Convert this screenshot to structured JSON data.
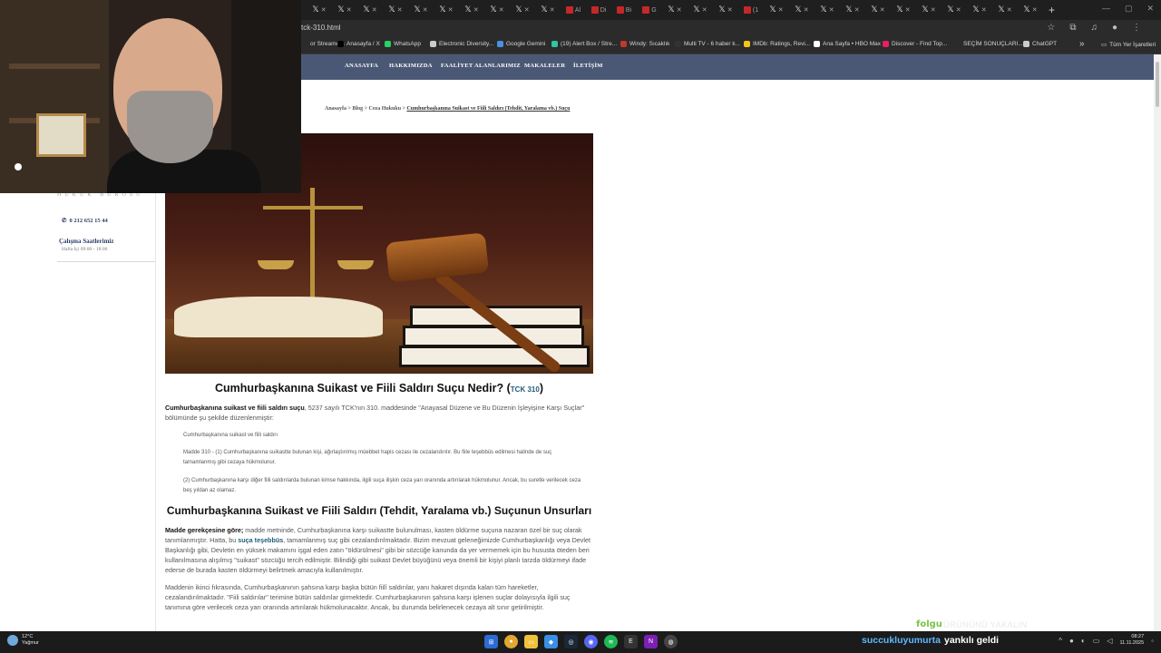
{
  "browser": {
    "url": "tck-310.html",
    "tabs": [
      {
        "type": "x"
      },
      {
        "type": "x"
      },
      {
        "type": "x"
      },
      {
        "type": "x"
      },
      {
        "type": "x"
      },
      {
        "type": "x"
      },
      {
        "type": "x"
      },
      {
        "type": "x"
      },
      {
        "type": "x"
      },
      {
        "type": "x"
      },
      {
        "type": "red",
        "label": "Al"
      },
      {
        "type": "red",
        "label": "Di"
      },
      {
        "type": "red",
        "label": "Bi"
      },
      {
        "type": "red",
        "label": "G"
      },
      {
        "type": "x"
      },
      {
        "type": "x"
      },
      {
        "type": "x"
      },
      {
        "type": "red",
        "label": "(1"
      },
      {
        "type": "x"
      },
      {
        "type": "x"
      },
      {
        "type": "x"
      },
      {
        "type": "x"
      },
      {
        "type": "x"
      },
      {
        "type": "x"
      },
      {
        "type": "x"
      },
      {
        "type": "x"
      },
      {
        "type": "x"
      },
      {
        "type": "x"
      },
      {
        "type": "x"
      }
    ],
    "new_tab": "+",
    "bookmarks": [
      {
        "label": "or Streamers",
        "color": "#2b2b2b"
      },
      {
        "label": "Anasayfa / X",
        "color": "#000000"
      },
      {
        "label": "WhatsApp",
        "color": "#25d366"
      },
      {
        "label": "Electronic Diversity...",
        "color": "#cccccc"
      },
      {
        "label": "Google Gemini",
        "color": "#4a90e2"
      },
      {
        "label": "(19) Alert Box / Stre...",
        "color": "#31c3a2"
      },
      {
        "label": "Windy: Sıcaklık",
        "color": "#c0392b"
      },
      {
        "label": "Multi TV - 6 haber k...",
        "color": "#333333"
      },
      {
        "label": "IMDb: Ratings, Revi...",
        "color": "#f5c518"
      },
      {
        "label": "Ana Sayfa • HBO Max",
        "color": "#ffffff"
      },
      {
        "label": "Discover - Find Top...",
        "color": "#e91e63"
      },
      {
        "label": "SEÇİM SONUÇLARI...",
        "color": "#2b2b2b"
      },
      {
        "label": "ChatGPT",
        "color": "#cccccc"
      }
    ],
    "bookmarks_more": "»",
    "all_bookmarks": "Tüm Yer İşaretleri"
  },
  "site": {
    "nav": [
      "ANASAYFA",
      "HAKKIMIZDA",
      "FAALİYET ALANLARIMIZ",
      "MAKALELER",
      "İLETİŞİM"
    ],
    "sidebar": {
      "tagline": "HUKUK BÜROSU",
      "phone": "0 212 652 15 44",
      "hours_title": "Çalışma Saatlerimiz",
      "hours": "Hafta İçi 09:00 - 18:00"
    },
    "breadcrumb": {
      "items": [
        "Anasayfa",
        "Blog",
        "Ceza Hukuku"
      ],
      "separator": ">",
      "current": "Cumhurbaşkanına Suikast ve Fiili Saldırı (Tehdit, Yaralama vb.) Suçu"
    }
  },
  "article": {
    "title": "Cumhurbaşkanına Suikast ve Fiili Saldırı Suçu Nedir? (",
    "title_link": "TCK 310",
    "title_end": ")",
    "intro_bold": "Cumhurbaşkanına suikast ve fiili saldırı suçu",
    "intro_rest": ", 5237 sayılı TCK'nın 310. maddesinde \"Anayasal Düzene ve Bu Düzenin İşleyişine Karşı Suçlar\" bölümünde şu şekilde düzenlenmiştir:",
    "quote_title": "Cumhurbaşkanına suikast ve fiili saldırı",
    "quote_1": "Madde 310 - (1) Cumhurbaşkanına suikastte bulunan kişi, ağırlaştırılmış müebbet hapis cezası ile cezalandırılır. Bu fiile teşebbüs edilmesi halinde de suç tamamlanmış gibi cezaya hükmolunur.",
    "quote_2": "(2) Cumhurbaşkanına karşı diğer fiili saldırılarda bulunan kimse hakkında, ilgili suça ilişkin ceza yarı oranında artırılarak hükmolunur. Ancak, bu suretle verilecek ceza beş yıldan az olamaz.",
    "h2": "Cumhurbaşkanına Suikast ve Fiili Saldırı (Tehdit, Yaralama vb.) Suçunun Unsurları",
    "p2_bold": "Madde gerekçesine göre;",
    "p2_a": " madde metninde, Cumhurbaşkanına karşı suikastte bulunulması, kasten öldürme suçuna nazaran özel bir suç olarak tanımlanmıştır. Hatta, bu ",
    "p2_link": "suça teşebbüs",
    "p2_b": ", tamamlanmış suç gibi cezalandırılmaktadır. Bizim mevzuat geleneğimizde Cumhurbaşkanlığı veya Devlet Başkanlığı gibi, Devletin en yüksek makamını işgal eden zatın \"öldürülmesi\" gibi bir sözcüğe kanunda da yer vermemek için bu hususta öteden beri kullanılmasına alışılmış \"suikast\" sözcüğü tercih edilmiştir. Bilindiği gibi suikast Devlet büyüğünü veya önemli bir kişiyi planlı tarzda öldürmeyi ifade ederse de burada kasten öldürmeyi belirtmek amacıyla kullanılmıştır.",
    "p3": "Maddenin ikinci fıkrasında, Cumhurbaşkanının şahsına karşı başka bütün fiilî saldırılar, yanı hakaret dışında kalan tüm hareketler, cezalandırılmaktadır. \"Fiili saldırılar\" terimine bütün saldırılar girmektedir. Cumhurbaşkanının şahsına karşı işlenen suçlar dolayısıyla ilgili suç tanımına göre verilecek ceza yarı oranında artırılarak hükmolunacaktır. Ancak, bu durumda belirlenecek cezaya alt sınır getirilmiştir."
  },
  "overlay": {
    "stream_logo": "folgu",
    "stream_tag": "ÜRÜNÜNÜ YAKALIN",
    "follower_name": "succukluyumurta",
    "follower_msg": "yankılı geldi"
  },
  "taskbar": {
    "weather_temp": "12°C",
    "weather_desc": "Yağmur",
    "time": "08:27",
    "date": "11.11.2025"
  }
}
